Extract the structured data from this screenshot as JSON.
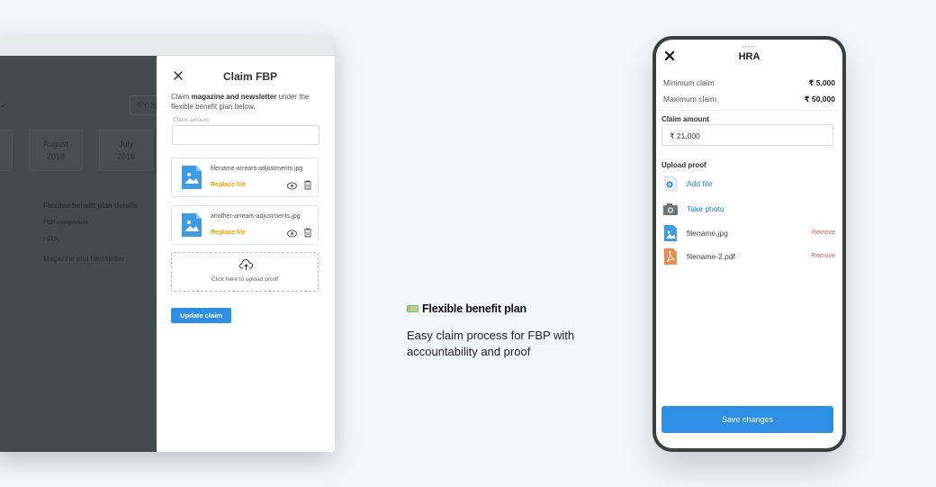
{
  "desktop": {
    "overlay": {
      "fy_label": "FY 20",
      "months": [
        {
          "month": "",
          "year": ""
        },
        {
          "month": "August",
          "year": "2018"
        },
        {
          "month": "July",
          "year": "2018"
        }
      ],
      "details_title": "Flexible benefit plan details",
      "component_header": "FBP component",
      "rows": [
        "HRA",
        "Magazine and Newsletter"
      ]
    },
    "panel": {
      "title": "Claim FBP",
      "desc_prefix": "Claim ",
      "desc_bold": "magazine and newsletter",
      "desc_suffix": " under the flexible benefit plan below.",
      "amount_placeholder": "Claim amount",
      "files": [
        {
          "name": "filename-arrears-adjustments.jpg",
          "action": "Replace file"
        },
        {
          "name": "another-arrears-adjustments.jpg",
          "action": "Replace file"
        }
      ],
      "upload_text": "Click here to upload proof",
      "update_button": "Update claim"
    }
  },
  "feature": {
    "title": "Flexible benefit plan",
    "description": "Easy claim process for FBP with accountability and proof"
  },
  "phone": {
    "title": "HRA",
    "min_label": "Minimum claim",
    "min_value": "₹ 5,000",
    "max_label": "Maximum claim",
    "max_value": "₹ 50,000",
    "amount_label": "Claim amount",
    "amount_value": "₹ 21,000",
    "upload_label": "Upload proof",
    "add_file": "Add file",
    "take_photo": "Take photo",
    "files": [
      {
        "name": "filename.jpg",
        "remove": "Remove"
      },
      {
        "name": "filename-2.pdf",
        "remove": "Remove"
      }
    ],
    "save_button": "Save changes"
  },
  "colors": {
    "accent": "#2d8ee4",
    "warning": "#f0a500",
    "danger": "#e85a5a",
    "background": "#f2f9fc",
    "overlay": "#444b4e"
  }
}
